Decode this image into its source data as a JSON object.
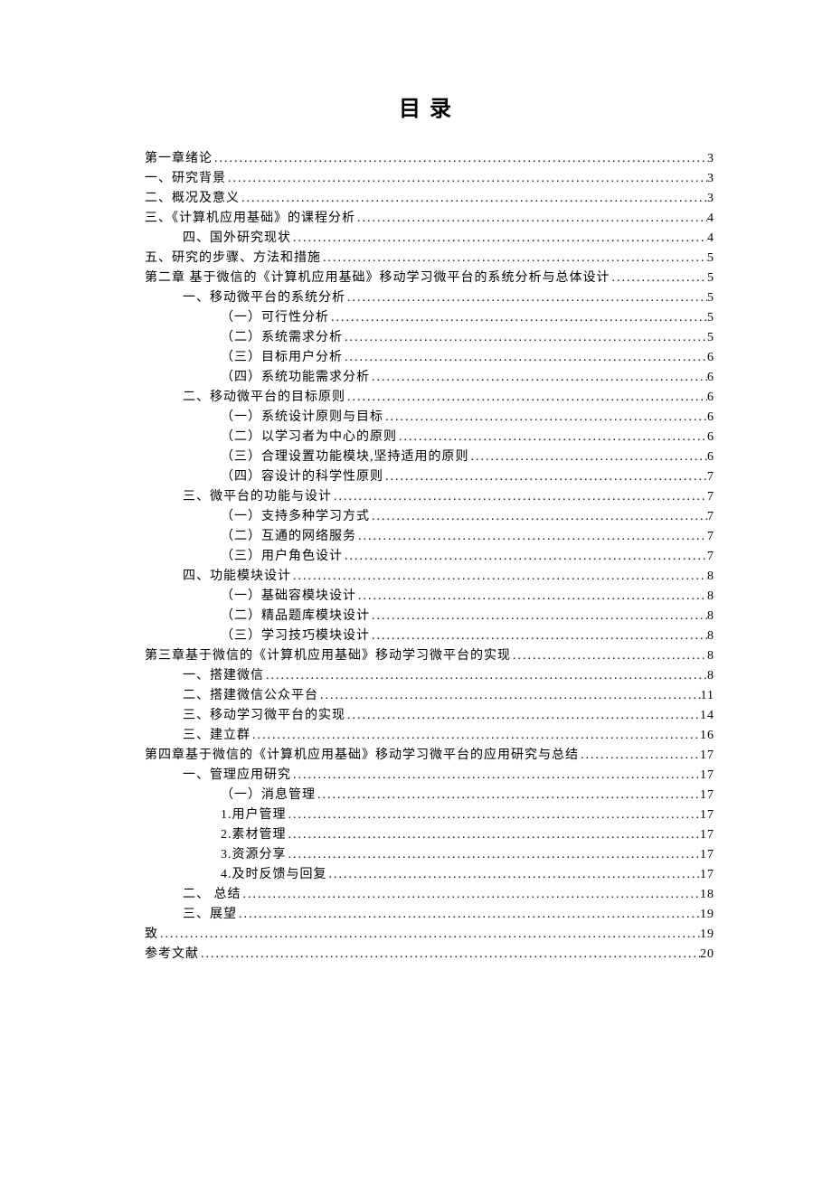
{
  "title": "目录",
  "entries": [
    {
      "text": "第一章绪论",
      "page": "3",
      "level": 0
    },
    {
      "text": "一、研究背景",
      "page": "3",
      "level": 0
    },
    {
      "text": "二、概况及意义",
      "page": "3",
      "level": 0
    },
    {
      "text": "三、《计算机应用基础》的课程分析",
      "page": "4",
      "level": 0
    },
    {
      "text": "四、国外研究现状",
      "page": "4",
      "level": 1
    },
    {
      "text": "五、研究的步骤、方法和措施",
      "page": "5",
      "level": 0
    },
    {
      "text": "第二章 基于微信的《计算机应用基础》移动学习微平台的系统分析与总体设计",
      "page": "5",
      "level": 0
    },
    {
      "text": "一、移动微平台的系统分析",
      "page": "5",
      "level": 1
    },
    {
      "text": "（一）可行性分析",
      "page": "5",
      "level": 2
    },
    {
      "text": "（二）系统需求分析",
      "page": "5",
      "level": 2
    },
    {
      "text": "（三）目标用户分析",
      "page": "6",
      "level": 2
    },
    {
      "text": "（四）系统功能需求分析",
      "page": "6",
      "level": 2
    },
    {
      "text": "二、移动微平台的目标原则",
      "page": "6",
      "level": 1
    },
    {
      "text": "（一）系统设计原则与目标",
      "page": "6",
      "level": 2
    },
    {
      "text": "（二）以学习者为中心的原则",
      "page": "6",
      "level": 2
    },
    {
      "text": "（三）合理设置功能模块,坚持适用的原则",
      "page": "6",
      "level": 2
    },
    {
      "text": "（四）容设计的科学性原则",
      "page": "7",
      "level": 2
    },
    {
      "text": "三、微平台的功能与设计",
      "page": "7",
      "level": 1
    },
    {
      "text": "（一）支持多种学习方式",
      "page": "7",
      "level": 2
    },
    {
      "text": "（二）互通的网络服务",
      "page": "7",
      "level": 2
    },
    {
      "text": "（三）用户角色设计",
      "page": "7",
      "level": 2
    },
    {
      "text": "四、功能模块设计",
      "page": "8",
      "level": 1
    },
    {
      "text": "（一）基础容模块设计",
      "page": "8",
      "level": 2
    },
    {
      "text": "（二）精品题库模块设计",
      "page": "8",
      "level": 2
    },
    {
      "text": "（三）学习技巧模块设计",
      "page": "8",
      "level": 2
    },
    {
      "text": "第三章基于微信的《计算机应用基础》移动学习微平台的实现",
      "page": "8",
      "level": 0
    },
    {
      "text": "一、搭建微信",
      "page": "8",
      "level": 1
    },
    {
      "text": "二、搭建微信公众平台",
      "page": "11",
      "level": 1
    },
    {
      "text": "三、移动学习微平台的实现",
      "page": "14",
      "level": 1
    },
    {
      "text": "三、建立群",
      "page": "16",
      "level": 1
    },
    {
      "text": "第四章基于微信的《计算机应用基础》移动学习微平台的应用研究与总结",
      "page": "17",
      "level": 0
    },
    {
      "text": "一、管理应用研究",
      "page": "17",
      "level": 1
    },
    {
      "text": "（一）消息管理",
      "page": "17",
      "level": 2
    },
    {
      "text": "1.用户管理",
      "page": "17",
      "level": 2
    },
    {
      "text": "2.素材管理",
      "page": "17",
      "level": 2
    },
    {
      "text": "3.资源分享",
      "page": "17",
      "level": 2
    },
    {
      "text": "4.及时反馈与回复",
      "page": "17",
      "level": 2
    },
    {
      "text": "二、 总结",
      "page": "18",
      "level": 1
    },
    {
      "text": "三、展望",
      "page": "19",
      "level": 1
    },
    {
      "text": "致",
      "page": "19",
      "level": 0
    },
    {
      "text": "参考文献",
      "page": "20",
      "level": 0
    }
  ]
}
